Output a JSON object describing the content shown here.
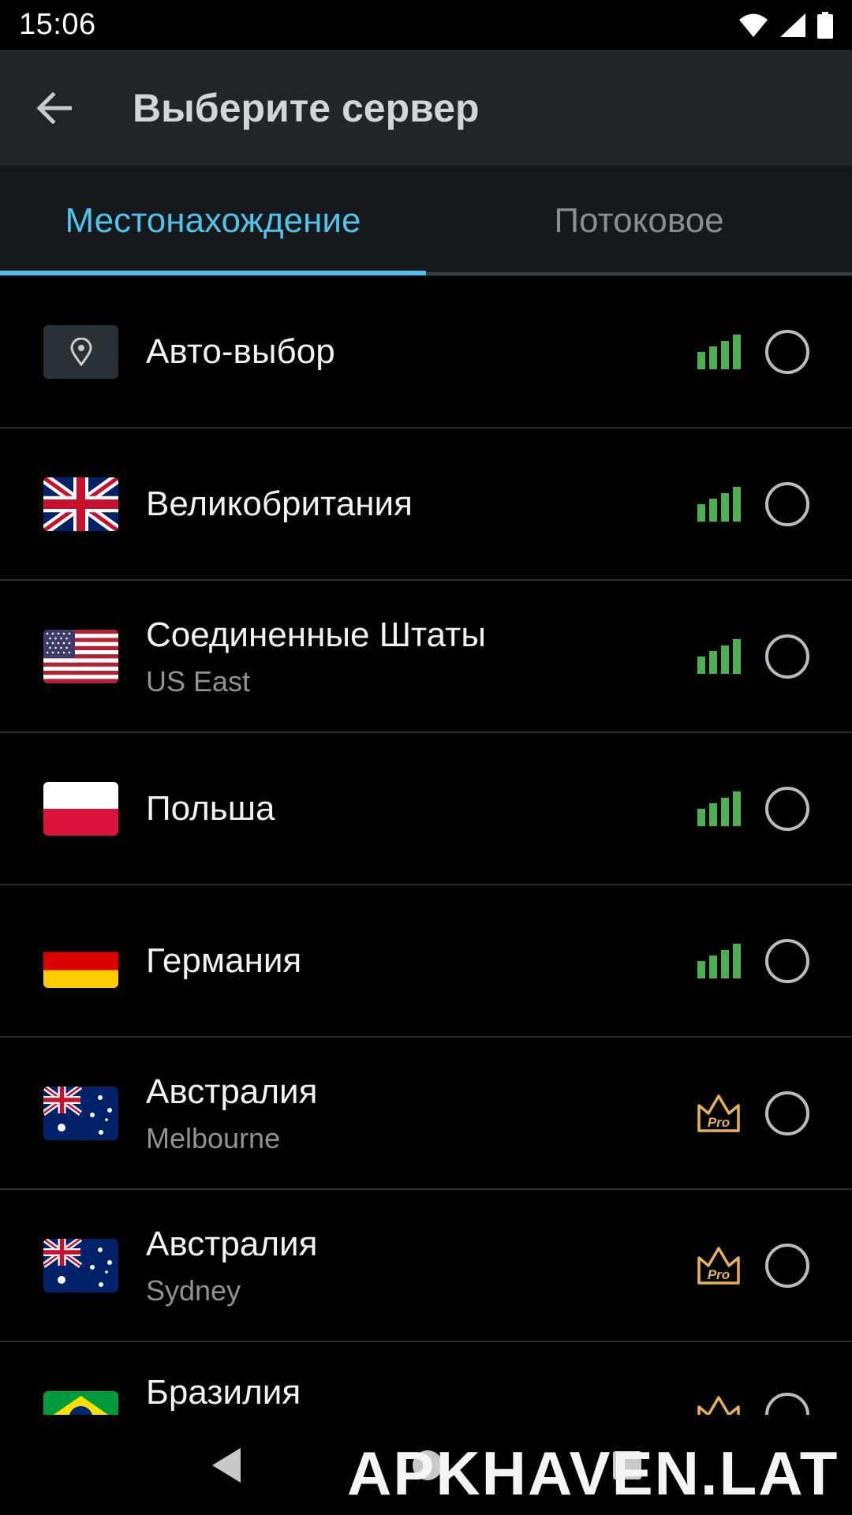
{
  "status_bar": {
    "time": "15:06"
  },
  "toolbar": {
    "title": "Выберите сервер"
  },
  "tabs": [
    {
      "label": "Местонахождение",
      "active": true
    },
    {
      "label": "Потоковое",
      "active": false
    }
  ],
  "servers": [
    {
      "title": "Авто-выбор",
      "subtitle": "",
      "flag": "location-pin",
      "badge": "signal"
    },
    {
      "title": "Великобритания",
      "subtitle": "",
      "flag": "uk-flag",
      "badge": "signal"
    },
    {
      "title": "Соединенные Штаты",
      "subtitle": "US East",
      "flag": "us-flag",
      "badge": "signal"
    },
    {
      "title": "Польша",
      "subtitle": "",
      "flag": "poland-flag",
      "badge": "signal"
    },
    {
      "title": "Германия",
      "subtitle": "",
      "flag": "germany-flag",
      "badge": "signal"
    },
    {
      "title": "Австралия",
      "subtitle": "Melbourne",
      "flag": "australia-flag",
      "badge": "pro"
    },
    {
      "title": "Австралия",
      "subtitle": "Sydney",
      "flag": "australia-flag",
      "badge": "pro"
    },
    {
      "title": "Бразилия",
      "subtitle": "",
      "flag": "brazil-flag",
      "badge": "pro"
    }
  ],
  "pro_label": "Pro",
  "watermark": "APKHAVEN.LAT",
  "colors": {
    "accent": "#4fc3e8",
    "signal": "#4caf50",
    "pro": "#e3b25a",
    "toolbar": "#202528"
  }
}
